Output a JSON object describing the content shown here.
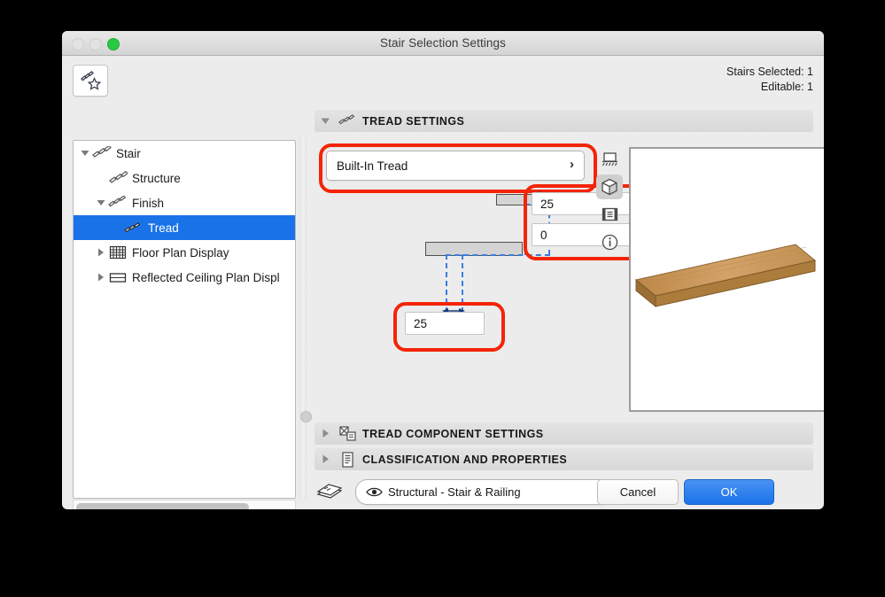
{
  "window": {
    "title": "Stair Selection Settings",
    "traffic_lights": [
      "close-disabled",
      "minimize-disabled",
      "zoom-green"
    ]
  },
  "toolbar": {
    "favorites_icon": "stair-favorite-icon",
    "stairs_selected": "Stairs Selected: 1",
    "editable": "Editable: 1"
  },
  "tree": {
    "items": [
      {
        "label": "Stair",
        "icon": "stair-icon",
        "indent": 0,
        "twisty": "down",
        "selected": false
      },
      {
        "label": "Structure",
        "icon": "structure-icon",
        "indent": 1,
        "twisty": "none",
        "selected": false
      },
      {
        "label": "Finish",
        "icon": "finish-icon",
        "indent": 1,
        "twisty": "down",
        "selected": false
      },
      {
        "label": "Tread",
        "icon": "tread-icon",
        "indent": 2,
        "twisty": "none",
        "selected": true
      },
      {
        "label": "Floor Plan Display",
        "icon": "floor-plan-icon",
        "indent": 1,
        "twisty": "right",
        "selected": false
      },
      {
        "label": "Reflected Ceiling Plan Displ",
        "icon": "ceiling-plan-icon",
        "indent": 1,
        "twisty": "right",
        "selected": false
      }
    ]
  },
  "sections": {
    "tread_settings": {
      "label": "TREAD SETTINGS",
      "icon": "tread-icon",
      "expanded": true
    },
    "tread_component": {
      "label": "TREAD COMPONENT SETTINGS",
      "icon": "component-icon",
      "expanded": false
    },
    "classification": {
      "label": "CLASSIFICATION AND PROPERTIES",
      "icon": "document-icon",
      "expanded": false
    }
  },
  "tread": {
    "type_value": "Built-In Tread",
    "chevron": "chevron-right-icon",
    "nosing_value": "25",
    "overhang_value": "0",
    "thickness_value": "25"
  },
  "view_icons": [
    {
      "name": "section-view-icon",
      "active": false
    },
    {
      "name": "3d-view-icon",
      "active": true
    },
    {
      "name": "elevation-view-icon",
      "active": false
    },
    {
      "name": "info-icon",
      "active": false
    }
  ],
  "preview": {
    "name": "tread-3d-preview",
    "material": "wood",
    "color": "#c08b4e"
  },
  "footer": {
    "layers_icon": "layers-icon",
    "eye_icon": "eye-icon",
    "layer_value": "Structural - Stair & Railing",
    "layer_chevron": "chevron-right-icon",
    "cancel_label": "Cancel",
    "ok_label": "OK"
  },
  "highlights": {
    "color": "#f42406",
    "count": 3
  }
}
